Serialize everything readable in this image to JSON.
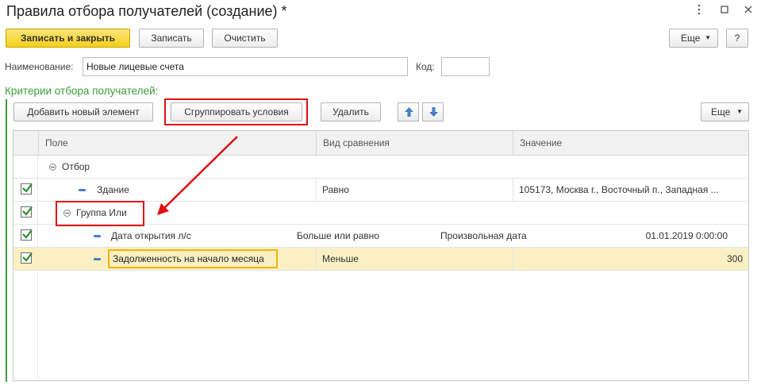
{
  "window": {
    "title": "Правила отбора получателей (создание) *",
    "controls": {
      "menu_icon": "vertical-ellipsis-icon",
      "maximize_icon": "maximize-icon",
      "close_icon": "close-icon"
    }
  },
  "toolbar": {
    "save_close_label": "Записать и закрыть",
    "save_label": "Записать",
    "clear_label": "Очистить",
    "more_label": "Еще",
    "help_label": "?"
  },
  "form": {
    "name_label": "Наименование:",
    "name_value": "Новые лицевые счета",
    "code_label": "Код:",
    "code_value": ""
  },
  "criteria": {
    "section_title": "Критерии отбора получателей:",
    "add_label": "Добавить новый элемент",
    "group_label": "Сгруппировать условия",
    "delete_label": "Удалить",
    "more_label": "Еще",
    "columns": [
      "Поле",
      "Вид сравнения",
      "Значение"
    ],
    "rows": [
      {
        "field": "Отбор",
        "comparison": "",
        "value": "",
        "checked": false,
        "type": "group-root"
      },
      {
        "field": "Здание",
        "comparison": "Равно",
        "value": "105173, Москва г., Восточный п., Западная ...",
        "checked": true,
        "type": "item"
      },
      {
        "field": "Группа Или",
        "comparison": "",
        "value": "",
        "checked": true,
        "type": "group"
      },
      {
        "field": "Дата открытия л/с",
        "comparison": "Больше или равно",
        "value_kind": "Произвольная дата",
        "value": "01.01.2019 0:00:00",
        "checked": true,
        "type": "item"
      },
      {
        "field": "Задолженность на начало месяца",
        "comparison": "Меньше",
        "value": "300",
        "checked": true,
        "type": "item"
      }
    ]
  },
  "colors": {
    "accent_green": "#3a9e3a",
    "primary_button": "#f4cf1a",
    "selected_row": "#fbf0c4",
    "annotation_red": "#e01010",
    "arrow_blue": "#4a7fc1"
  }
}
